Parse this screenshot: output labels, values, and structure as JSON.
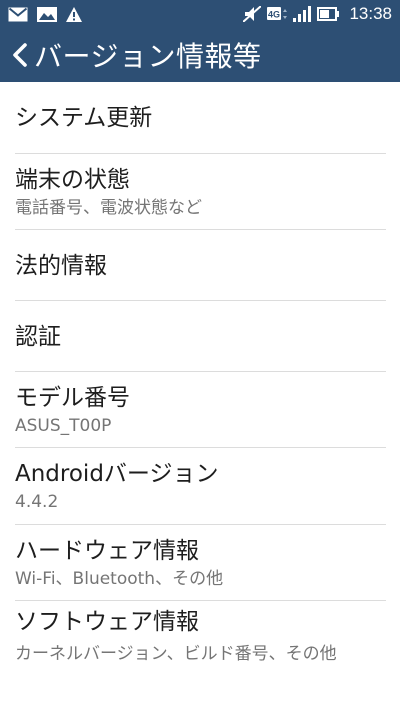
{
  "status_bar": {
    "time": "13:38",
    "network_label": "4G",
    "icons": [
      "mail-icon",
      "image-icon",
      "warning-icon",
      "mute-icon",
      "signal-icon",
      "battery-icon"
    ]
  },
  "header": {
    "title": "バージョン情報等",
    "back_icon": "chevron-left-icon"
  },
  "items": [
    {
      "title": "システム更新",
      "subtitle": ""
    },
    {
      "title": "端末の状態",
      "subtitle": "電話番号、電波状態など"
    },
    {
      "title": "法的情報",
      "subtitle": ""
    },
    {
      "title": "認証",
      "subtitle": ""
    },
    {
      "title": "モデル番号",
      "subtitle": "ASUS_T00P"
    },
    {
      "title": "Androidバージョン",
      "subtitle": "4.4.2"
    },
    {
      "title": "ハードウェア情報",
      "subtitle": "Wi-Fi、Bluetooth、その他"
    },
    {
      "title": "ソフトウェア情報",
      "subtitle": "カーネルバージョン、ビルド番号、その他"
    }
  ],
  "colors": {
    "app_bar": "#2d4f74",
    "divider": "#dcdcdc",
    "title_text": "#1e1e1e",
    "subtitle_text": "#757575"
  }
}
